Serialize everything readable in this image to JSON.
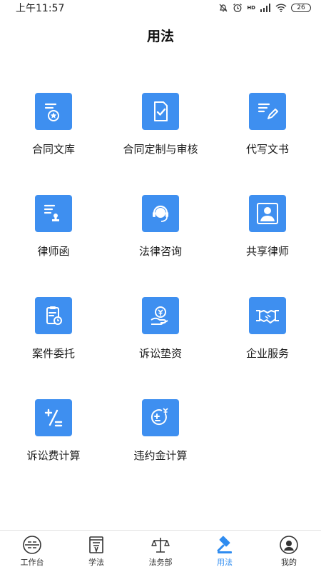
{
  "status_bar": {
    "time": "上午11:57",
    "battery": "26",
    "hd_label": "HD"
  },
  "header": {
    "title": "用法"
  },
  "services": [
    {
      "label": "合同文库",
      "icon": "contract-library-icon"
    },
    {
      "label": "合同定制与审核",
      "icon": "contract-review-icon"
    },
    {
      "label": "代写文书",
      "icon": "document-writing-icon"
    },
    {
      "label": "律师函",
      "icon": "lawyer-letter-icon"
    },
    {
      "label": "法律咨询",
      "icon": "legal-consult-icon"
    },
    {
      "label": "共享律师",
      "icon": "shared-lawyer-icon"
    },
    {
      "label": "案件委托",
      "icon": "case-entrust-icon"
    },
    {
      "label": "诉讼垫资",
      "icon": "litigation-funding-icon"
    },
    {
      "label": "企业服务",
      "icon": "enterprise-service-icon"
    },
    {
      "label": "诉讼费计算",
      "icon": "litigation-fee-calc-icon"
    },
    {
      "label": "违约金计算",
      "icon": "penalty-calc-icon"
    }
  ],
  "tabbar": {
    "active": "用法",
    "items": [
      {
        "label": "工作台",
        "icon": "workbench-icon"
      },
      {
        "label": "学法",
        "icon": "study-law-icon"
      },
      {
        "label": "法务部",
        "icon": "legal-dept-icon"
      },
      {
        "label": "用法",
        "icon": "gavel-icon"
      },
      {
        "label": "我的",
        "icon": "profile-icon"
      }
    ]
  },
  "colors": {
    "tile": "#3e8ff0",
    "accent": "#2f8cf0"
  }
}
